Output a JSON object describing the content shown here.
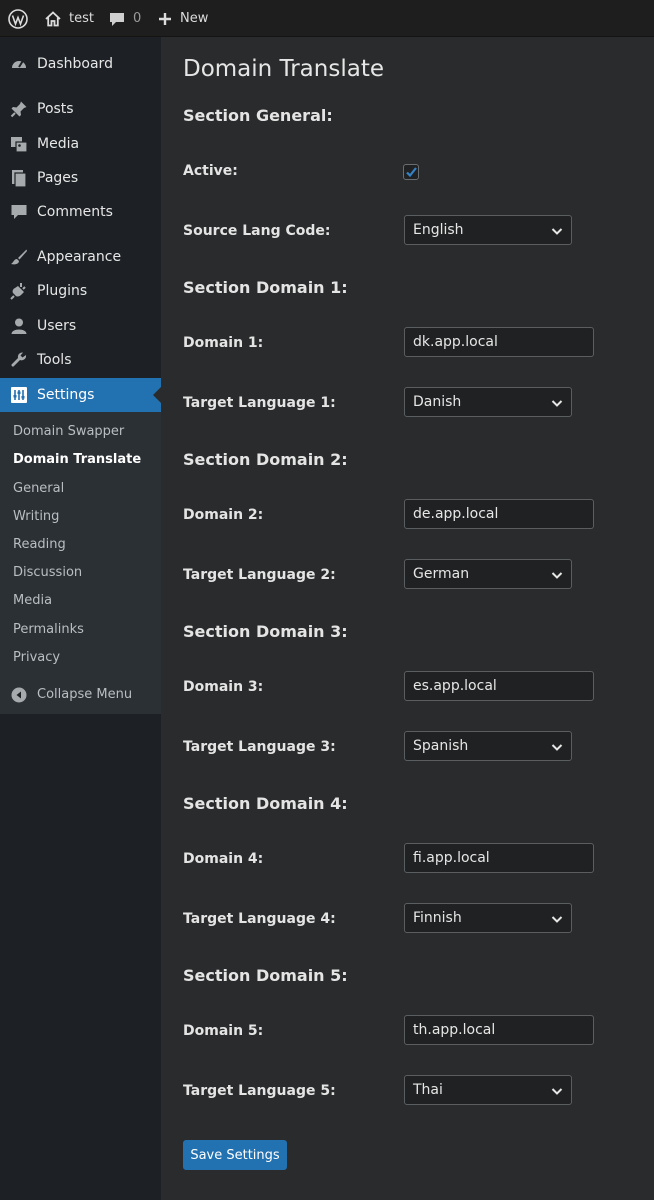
{
  "admin_bar": {
    "site_name": "test",
    "comments_count": "0",
    "new_label": "New",
    "icons": [
      "wordpress-logo-icon",
      "home-icon",
      "comment-icon",
      "plus-icon"
    ]
  },
  "sidebar": {
    "menu": [
      {
        "label": "Dashboard",
        "icon": "dashboard-icon"
      },
      {
        "label": "Posts",
        "icon": "pin-icon"
      },
      {
        "label": "Media",
        "icon": "media-icon"
      },
      {
        "label": "Pages",
        "icon": "pages-icon"
      },
      {
        "label": "Comments",
        "icon": "comment-icon"
      },
      {
        "label": "Appearance",
        "icon": "brush-icon"
      },
      {
        "label": "Plugins",
        "icon": "plug-icon"
      },
      {
        "label": "Users",
        "icon": "user-icon"
      },
      {
        "label": "Tools",
        "icon": "wrench-icon"
      },
      {
        "label": "Settings",
        "icon": "settings-icon"
      }
    ],
    "submenu": [
      "Domain Swapper",
      "Domain Translate",
      "General",
      "Writing",
      "Reading",
      "Discussion",
      "Media",
      "Permalinks",
      "Privacy"
    ],
    "collapse_label": "Collapse Menu",
    "accent_color": "#2271b1"
  },
  "main": {
    "title": "Domain Translate",
    "general": {
      "heading": "Section General:",
      "active_label": "Active:",
      "active_checked": true,
      "source_lang_label": "Source Lang Code:",
      "source_lang_value": "English"
    },
    "domains": [
      {
        "heading": "Section Domain 1:",
        "domain_label": "Domain 1:",
        "domain_value": "dk.app.local",
        "target_label": "Target Language 1:",
        "target_value": "Danish"
      },
      {
        "heading": "Section Domain 2:",
        "domain_label": "Domain 2:",
        "domain_value": "de.app.local",
        "target_label": "Target Language 2:",
        "target_value": "German"
      },
      {
        "heading": "Section Domain 3:",
        "domain_label": "Domain 3:",
        "domain_value": "es.app.local",
        "target_label": "Target Language 3:",
        "target_value": "Spanish"
      },
      {
        "heading": "Section Domain 4:",
        "domain_label": "Domain 4:",
        "domain_value": "fi.app.local",
        "target_label": "Target Language 4:",
        "target_value": "Finnish"
      },
      {
        "heading": "Section Domain 5:",
        "domain_label": "Domain 5:",
        "domain_value": "th.app.local",
        "target_label": "Target Language 5:",
        "target_value": "Thai"
      }
    ],
    "save_label": "Save Settings"
  }
}
